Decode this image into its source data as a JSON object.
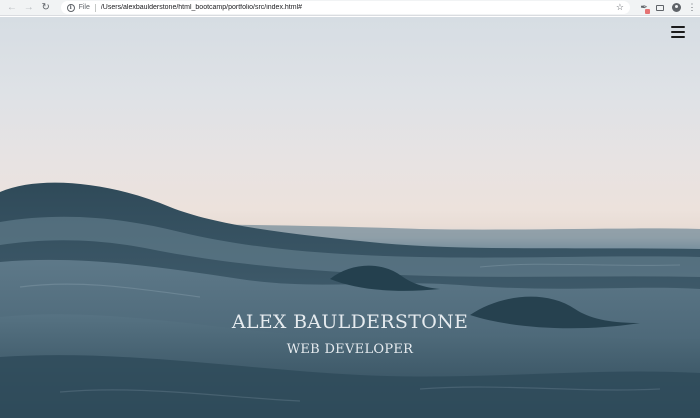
{
  "browser": {
    "scheme_label": "File",
    "url": "/Users/alexbaulderstone/html_bootcamp/portfolio/src/index.html#",
    "nav": {
      "back_icon": "arrow-left-icon",
      "forward_icon": "arrow-right-icon",
      "reload_icon": "reload-icon"
    }
  },
  "page": {
    "name": "ALEX BAULDERSTONE",
    "role": "WEB DEVELOPER",
    "menu_icon": "hamburger-menu-icon"
  },
  "colors": {
    "sky_top": "#d6dde3",
    "horizon": "#ece2dc",
    "sea": "#3f5b6b",
    "hero_text": "#e6ebef",
    "menu_icon": "#1b1b1b"
  }
}
